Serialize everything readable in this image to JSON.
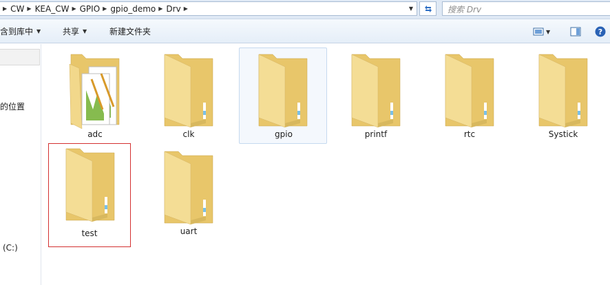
{
  "address_bar": {
    "crumbs": [
      "CW",
      "KEA_CW",
      "GPIO",
      "gpio_demo",
      "Drv"
    ]
  },
  "search": {
    "placeholder": "搜索 Drv"
  },
  "toolbar": {
    "include_library_label": "含到库中",
    "share_label": "共享",
    "new_folder_label": "新建文件夹"
  },
  "nav": {
    "items": [
      {
        "label": "的位置"
      },
      {
        "label": "(C:)"
      }
    ]
  },
  "folders": [
    {
      "name": "adc",
      "type": "document-folder"
    },
    {
      "name": "clk",
      "type": "folder"
    },
    {
      "name": "gpio",
      "type": "folder",
      "selected": true
    },
    {
      "name": "printf",
      "type": "folder"
    },
    {
      "name": "rtc",
      "type": "folder"
    },
    {
      "name": "Systick",
      "type": "folder"
    },
    {
      "name": "test",
      "type": "folder",
      "outlined": true
    },
    {
      "name": "uart",
      "type": "folder"
    }
  ],
  "colors": {
    "folder_body": "#f2d88b",
    "folder_back": "#e8c66a",
    "selection": "#c5d9ef",
    "highlight_box": "#d33030"
  }
}
